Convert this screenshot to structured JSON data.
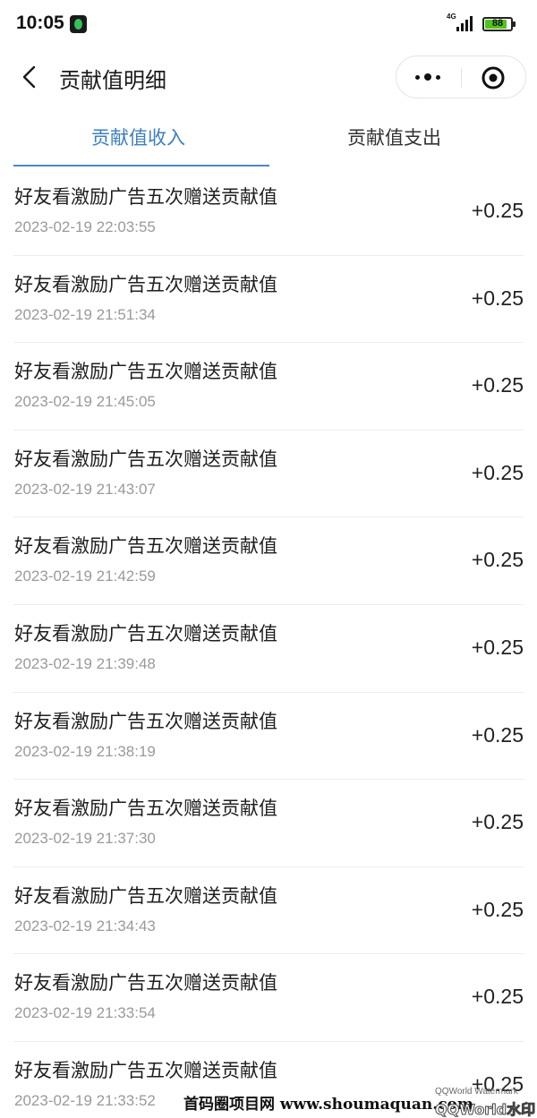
{
  "status_bar": {
    "time": "10:05",
    "network": "4G",
    "battery": "88",
    "battery_level_percent": 88,
    "battery_color": "#52c41a"
  },
  "nav": {
    "title": "贡献值明细",
    "back_icon": "chevron-left-icon",
    "more_icon": "more-dots-icon",
    "close_icon": "target-circle-icon"
  },
  "tabs": [
    {
      "label": "贡献值收入",
      "active": true
    },
    {
      "label": "贡献值支出",
      "active": false
    }
  ],
  "accent_color": "#3d7fbf",
  "records": [
    {
      "name": "好友看激励广告五次赠送贡献值",
      "time": "2023-02-19 22:03:55",
      "amount": "+0.25"
    },
    {
      "name": "好友看激励广告五次赠送贡献值",
      "time": "2023-02-19 21:51:34",
      "amount": "+0.25"
    },
    {
      "name": "好友看激励广告五次赠送贡献值",
      "time": "2023-02-19 21:45:05",
      "amount": "+0.25"
    },
    {
      "name": "好友看激励广告五次赠送贡献值",
      "time": "2023-02-19 21:43:07",
      "amount": "+0.25"
    },
    {
      "name": "好友看激励广告五次赠送贡献值",
      "time": "2023-02-19 21:42:59",
      "amount": "+0.25"
    },
    {
      "name": "好友看激励广告五次赠送贡献值",
      "time": "2023-02-19 21:39:48",
      "amount": "+0.25"
    },
    {
      "name": "好友看激励广告五次赠送贡献值",
      "time": "2023-02-19 21:38:19",
      "amount": "+0.25"
    },
    {
      "name": "好友看激励广告五次赠送贡献值",
      "time": "2023-02-19 21:37:30",
      "amount": "+0.25"
    },
    {
      "name": "好友看激励广告五次赠送贡献值",
      "time": "2023-02-19 21:34:43",
      "amount": "+0.25"
    },
    {
      "name": "好友看激励广告五次赠送贡献值",
      "time": "2023-02-19 21:33:54",
      "amount": "+0.25"
    },
    {
      "name": "好友看激励广告五次赠送贡献值",
      "time": "2023-02-19 21:33:52",
      "amount": "+0.25"
    }
  ],
  "watermark": {
    "main": "首码圈项目网 www.shoumaquan.com",
    "qq_small": "QQWorld Watermark",
    "qq": "QQWorld水印"
  }
}
